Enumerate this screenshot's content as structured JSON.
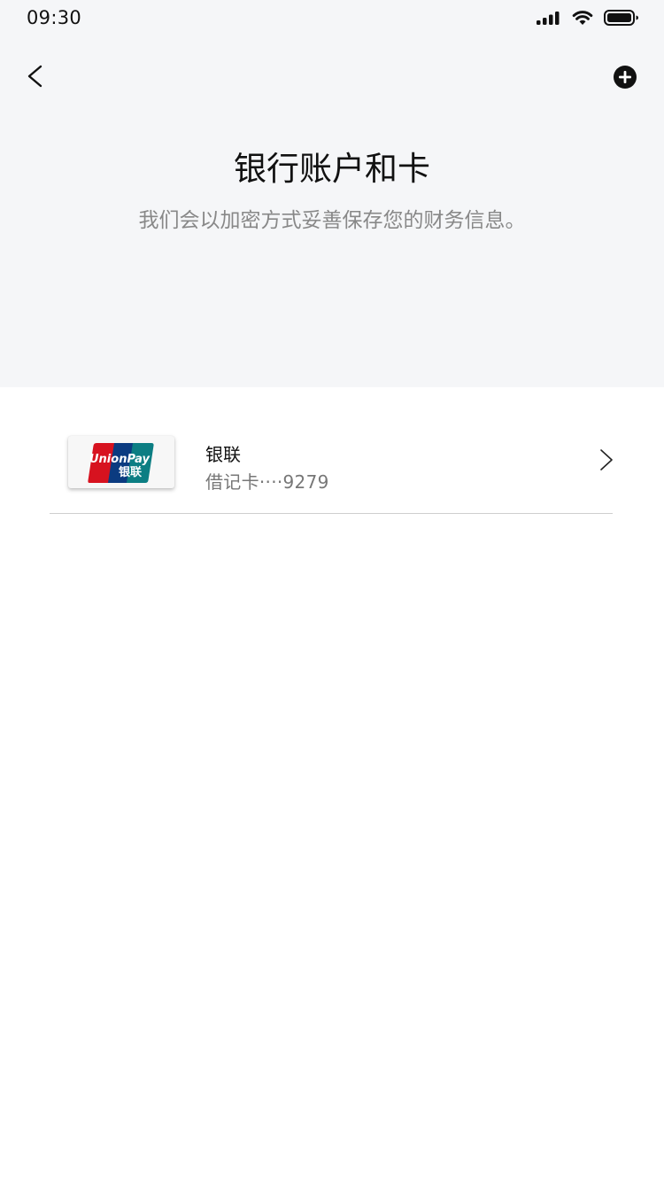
{
  "status_bar": {
    "time": "09:30"
  },
  "header": {
    "title": "银行账户和卡",
    "subtitle": "我们会以加密方式妥善保存您的财务信息。",
    "back_icon": "chevron-left-icon",
    "add_icon": "plus-circle-icon"
  },
  "cards": [
    {
      "brand_logo": "unionpay-logo",
      "logo_text_en": "UnionPay",
      "logo_text_cn": "银联",
      "name": "银联",
      "description": "借记卡····9279"
    }
  ],
  "colors": {
    "header_bg": "#f5f6f8",
    "unionpay_red": "#d7121f",
    "unionpay_blue": "#0b3b80",
    "unionpay_teal": "#0c7e83"
  }
}
